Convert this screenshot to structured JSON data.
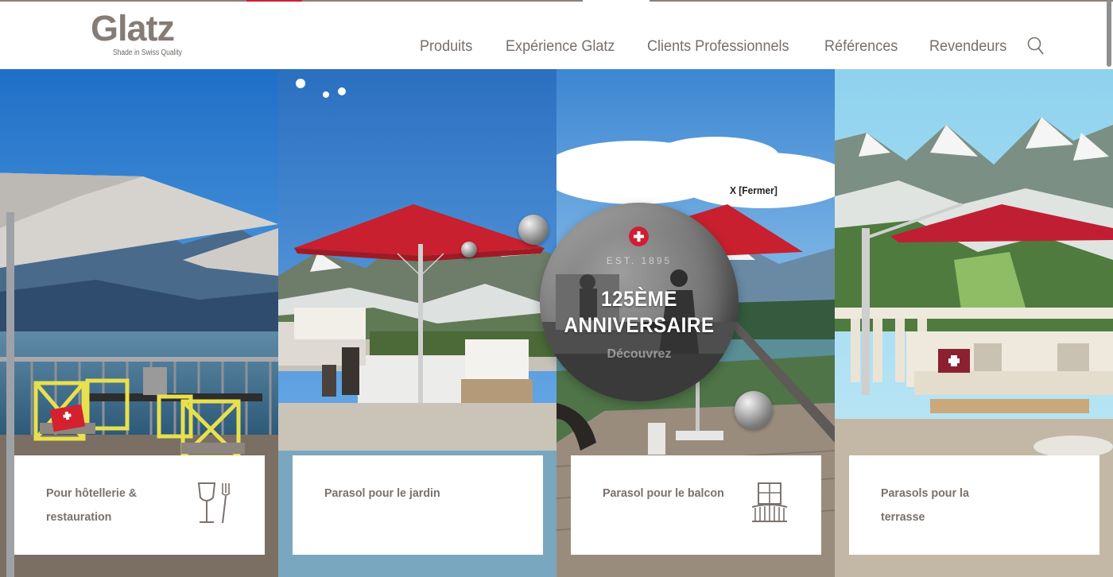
{
  "brand": {
    "name": "Glatz",
    "tagline": "Shade in Swiss Quality"
  },
  "nav": {
    "items": [
      {
        "label": "Produits"
      },
      {
        "label": "Expérience Glatz"
      },
      {
        "label": "Clients Professionnels"
      },
      {
        "label": "Références"
      },
      {
        "label": "Revendeurs"
      }
    ],
    "search_icon": "search-icon"
  },
  "panels": [
    {
      "label": "Pour hôtellerie & restauration",
      "icon": "wine-glass-fork-icon"
    },
    {
      "label": "Parasol pour le jardin",
      "icon": ""
    },
    {
      "label": "Parasol pour le balcon",
      "icon": "balcony-icon"
    },
    {
      "label": "Parasols pour la terrasse",
      "icon": ""
    }
  ],
  "anniversary": {
    "est": "EST. 1895",
    "title_line1": "125ÈME",
    "title_line2": "ANNIVERSAIRE",
    "cta": "Découvrez",
    "close": "X [Fermer]"
  },
  "colors": {
    "brand_gray": "#857c77",
    "nav_text": "#776f6a",
    "accent_red": "#cf1f35",
    "card_text": "#7a726d"
  }
}
